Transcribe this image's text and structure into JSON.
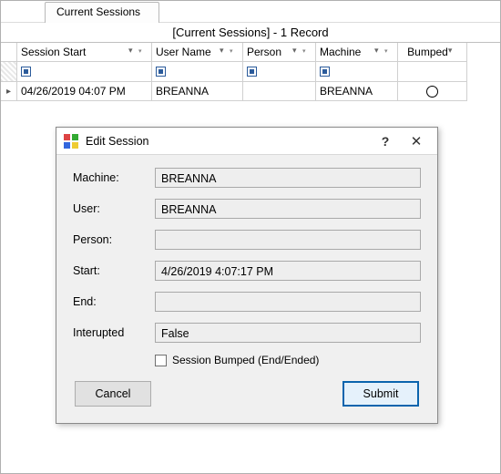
{
  "tab": {
    "label": "Current Sessions"
  },
  "title": "[Current Sessions] - 1 Record",
  "grid": {
    "columns": {
      "start": "Session Start",
      "user": "User Name",
      "person": "Person",
      "machine": "Machine",
      "bumped": "Bumped"
    },
    "row": {
      "start": "04/26/2019 04:07 PM",
      "user": "BREANNA",
      "person": "",
      "machine": "BREANNA"
    }
  },
  "dialog": {
    "title": "Edit Session",
    "labels": {
      "machine": "Machine:",
      "user": "User:",
      "person": "Person:",
      "start": "Start:",
      "end": "End:",
      "interrupted": "Interupted"
    },
    "values": {
      "machine": "BREANNA",
      "user": "BREANNA",
      "person": "",
      "start": "4/26/2019 4:07:17 PM",
      "end": "",
      "interrupted": "False"
    },
    "checkbox_label": "Session Bumped (End/Ended)",
    "buttons": {
      "cancel": "Cancel",
      "submit": "Submit"
    }
  }
}
